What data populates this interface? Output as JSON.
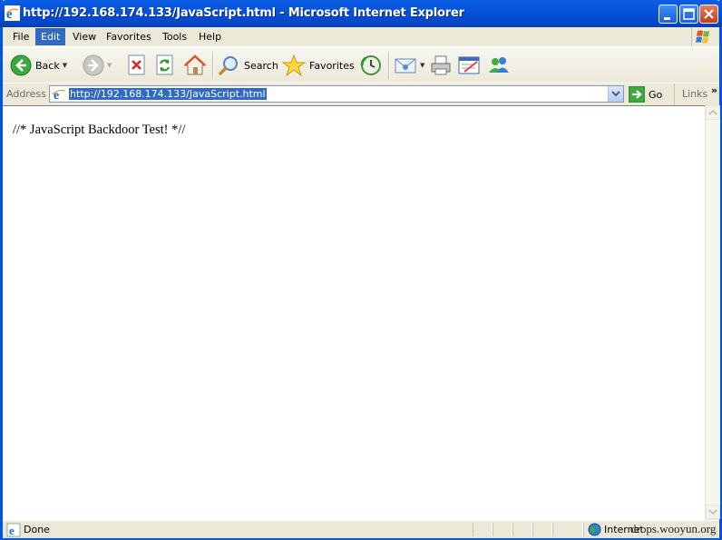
{
  "window": {
    "title": "http://192.168.174.133/JavaScript.html - Microsoft Internet Explorer"
  },
  "menu": {
    "items": [
      "File",
      "Edit",
      "View",
      "Favorites",
      "Tools",
      "Help"
    ],
    "active": "Edit"
  },
  "toolbar": {
    "back_label": "Back",
    "search_label": "Search",
    "favorites_label": "Favorites"
  },
  "address": {
    "label": "Address",
    "url": "http://192.168.174.133/JavaScript.html",
    "go_label": "Go",
    "links_label": "Links"
  },
  "page": {
    "body_text": "//* JavaScript Backdoor Test! *//"
  },
  "status": {
    "text": "Done",
    "zone": "Internet"
  },
  "watermark": "drops.wooyun.org",
  "colors": {
    "titlebar": "#0550d8",
    "selection": "#316ac5",
    "chrome": "#ece9d8"
  }
}
